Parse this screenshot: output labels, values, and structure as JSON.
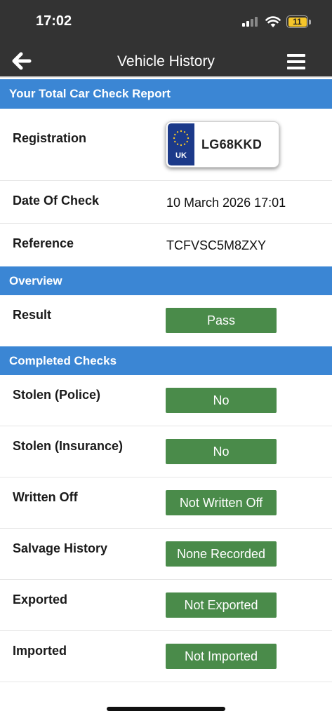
{
  "status_bar": {
    "time": "17:02",
    "battery_level": "11",
    "icons": [
      "cellular-signal-icon",
      "wifi-icon",
      "battery-icon"
    ]
  },
  "nav": {
    "title": "Vehicle History",
    "back_icon": "back-arrow-icon",
    "menu_icon": "hamburger-menu-icon"
  },
  "report": {
    "header": "Your Total Car Check Report",
    "registration_label": "Registration",
    "plate_country": "UK",
    "plate_number": "LG68KKD",
    "date_label": "Date Of Check",
    "date_value": "10 March 2026 17:01",
    "reference_label": "Reference",
    "reference_value": "TCFVSC5M8ZXY"
  },
  "overview": {
    "header": "Overview",
    "result_label": "Result",
    "result_value": "Pass"
  },
  "checks": {
    "header": "Completed Checks",
    "items": [
      {
        "label": "Stolen (Police)",
        "value": "No"
      },
      {
        "label": "Stolen (Insurance)",
        "value": "No"
      },
      {
        "label": "Written Off",
        "value": "Not Written Off"
      },
      {
        "label": "Salvage History",
        "value": "None Recorded"
      },
      {
        "label": "Exported",
        "value": "Not Exported"
      },
      {
        "label": "Imported",
        "value": "Not Imported"
      }
    ]
  },
  "colors": {
    "header_bar": "#333333",
    "section_header": "#3b86d4",
    "pass_green": "#4a8b4a",
    "battery": "#f5c52a",
    "plate_blue": "#1c3a8a"
  }
}
